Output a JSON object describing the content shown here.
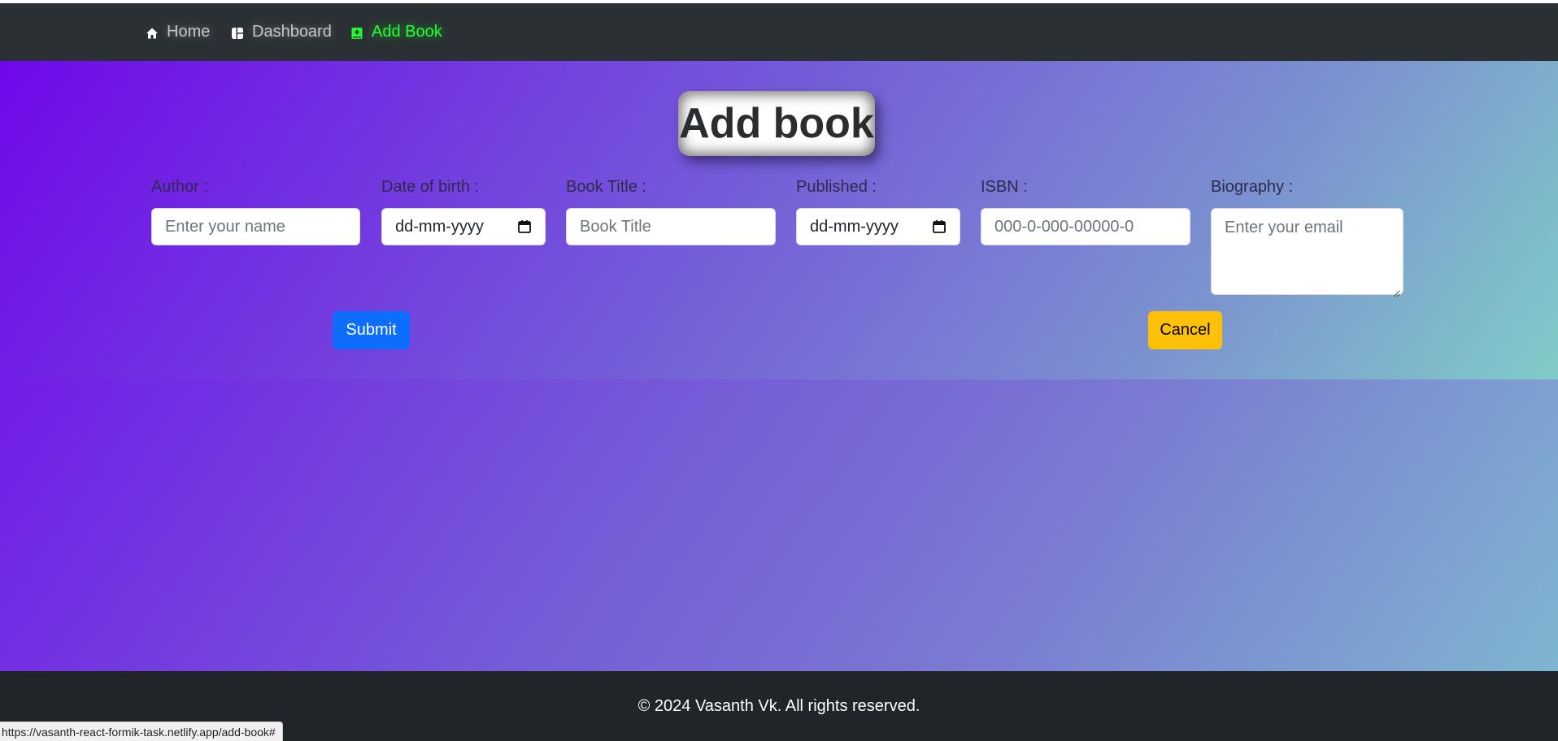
{
  "nav": {
    "items": [
      {
        "label": "Home",
        "icon": "home-icon"
      },
      {
        "label": "Dashboard",
        "icon": "dashboard-icon"
      },
      {
        "label": "Add Book",
        "icon": "book-plus-icon",
        "active": true
      }
    ]
  },
  "page": {
    "title": "Add book"
  },
  "form": {
    "author": {
      "label": "Author :",
      "placeholder": "Enter your name"
    },
    "dob": {
      "label": "Date of birth :",
      "value": "dd-mm-yyyy"
    },
    "book_title": {
      "label": "Book Title :",
      "placeholder": "Book Title"
    },
    "published": {
      "label": "Published :",
      "value": "dd-mm-yyyy"
    },
    "isbn": {
      "label": "ISBN :",
      "placeholder": "000-0-000-00000-0"
    },
    "biography": {
      "label": "Biography :",
      "placeholder": "Enter your email"
    },
    "submit_label": "Submit",
    "cancel_label": "Cancel"
  },
  "footer": {
    "text": "© 2024 Vasanth Vk. All rights reserved."
  },
  "status_bar": {
    "url": "https://vasanth-react-formik-task.netlify.app/add-book#"
  },
  "colors": {
    "navbar": "#2b3035",
    "active_nav": "#22ff2e",
    "submit": "#0d6efd",
    "cancel": "#ffc107",
    "footer": "#212529"
  }
}
